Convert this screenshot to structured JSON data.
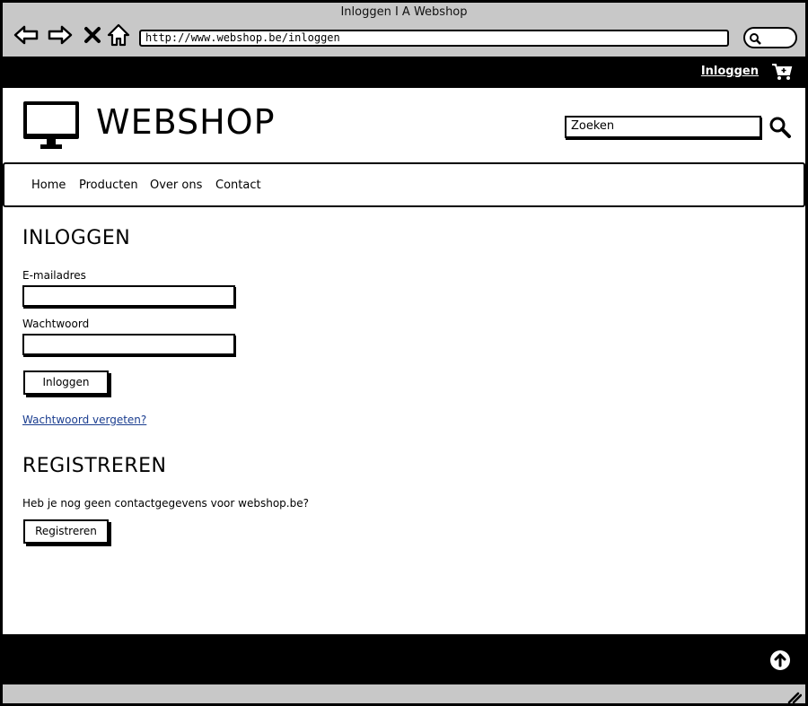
{
  "window": {
    "title": "Inloggen I A Webshop",
    "url": "http://www.webshop.be/inloggen"
  },
  "toolbar": {
    "icons": [
      "back-icon",
      "forward-icon",
      "close-icon",
      "home-icon",
      "search-icon"
    ]
  },
  "topbar": {
    "login_label": "Inloggen",
    "cart_icon": "cart-icon"
  },
  "header": {
    "logo_icon": "monitor-icon",
    "logo_text": "WEBSHOP",
    "search_placeholder": "Zoeken"
  },
  "menu": {
    "items": [
      {
        "label": "Home"
      },
      {
        "label": "Producten"
      },
      {
        "label": "Over ons"
      },
      {
        "label": "Contact"
      }
    ]
  },
  "login": {
    "title": "INLOGGEN",
    "email_label": "E-mailadres",
    "email_value": "",
    "password_label": "Wachtwoord",
    "password_value": "",
    "submit_label": "Inloggen",
    "forgot_link": "Wachtwoord vergeten?"
  },
  "register": {
    "title": "REGISTREREN",
    "text": "Heb je nog geen contactgegevens voor webshop.be?",
    "button_label": "Registreren"
  },
  "footer": {
    "up_icon": "arrow-up-circle-icon"
  },
  "colors": {
    "chrome": "#c8c8c8",
    "bar": "#000000",
    "link": "#1a3d8f"
  }
}
